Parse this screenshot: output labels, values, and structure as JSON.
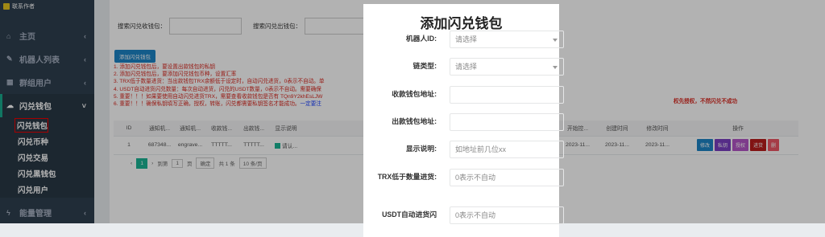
{
  "sidebar": {
    "contact": "联系作者",
    "items": [
      {
        "label": "主页",
        "icon": "home-icon"
      },
      {
        "label": "机器人列表",
        "icon": "wrench-icon"
      },
      {
        "label": "群组用户",
        "icon": "group-icon"
      },
      {
        "label": "闪兑钱包",
        "icon": "cloud-icon"
      }
    ],
    "sub_items": [
      "闪兑钱包",
      "闪兑币种",
      "闪兑交易",
      "闪兑黑钱包",
      "闪兑用户"
    ],
    "bottom_item": {
      "label": "能量管理",
      "icon": "lightning-icon"
    }
  },
  "search": {
    "receive_label": "搜索闪兑收钱包：",
    "send_label": "搜索闪兑出钱包："
  },
  "add_button": "添加闪兑钱包",
  "notes": [
    "1. 添加闪兑钱包后，要设置出款钱包的私钥",
    "2. 添加闪兑钱包后，要添加闪兑钱包币种，设置汇率",
    "3. TRX低于数量进货：当出款钱包TRX余额低于设定时，自动闪兑进货，0表示不自动。单",
    "4. USDT自动进货闪兑数量：每次自动进货，闪兑的USDT数量，0表示不自动。需要确保",
    "5. 重要！！！如果要使用自动闪兑进货TRX，需要查看收款钱包是否有 TQn9Y2khEsLJW",
    "6. 重要！！！确保私钥填写正确，授权，转账，闪兑都需要私钥签名才能成功。"
  ],
  "notes_highlight": "一定要注",
  "right_note": "权先授权，不然闪兑不成功",
  "table": {
    "headers": [
      "ID",
      "通知机...",
      "通知机...",
      "收款钱...",
      "出款钱...",
      "显示说明",
      "开始控...",
      "创建时间",
      "修改时间",
      "操作"
    ],
    "rows": [
      {
        "id": "1",
        "c1": "687348...",
        "c2": "engrave...",
        "c3": "TTTTT...",
        "c4": "TTTTT...",
        "c5": "请认...",
        "c6": "2023-11...",
        "c7": "2023-11...",
        "c8": "2023-11..."
      }
    ],
    "ops": [
      {
        "label": "修改",
        "color": "#1c84c6"
      },
      {
        "label": "私钥",
        "color": "#7a3fc2"
      },
      {
        "label": "授权",
        "color": "#b455c8"
      },
      {
        "label": "进货",
        "color": "#b91c1c"
      },
      {
        "label": "删",
        "color": "#ed5565"
      }
    ]
  },
  "pager": {
    "current": "1",
    "goto_label": "到第",
    "page_value": "1",
    "page_suffix": "页",
    "confirm": "确定",
    "total": "共 1 条",
    "per_page": "10 条/页"
  },
  "modal": {
    "title": "添加闪兑钱包",
    "fields": [
      {
        "label": "机器人ID:",
        "value": "请选择",
        "type": "select"
      },
      {
        "label": "链类型:",
        "value": "请选择",
        "type": "select"
      },
      {
        "label": "收款钱包地址:",
        "value": "",
        "type": "input"
      },
      {
        "label": "出款钱包地址:",
        "value": "",
        "type": "input"
      },
      {
        "label": "显示说明:",
        "value": "如地址前几位xx",
        "type": "input"
      },
      {
        "label": "TRX低于数量进货:",
        "value": "0表示不自动",
        "type": "input"
      },
      {
        "label": "USDT自动进货闪",
        "value": "0表示不自动",
        "type": "input"
      }
    ]
  }
}
